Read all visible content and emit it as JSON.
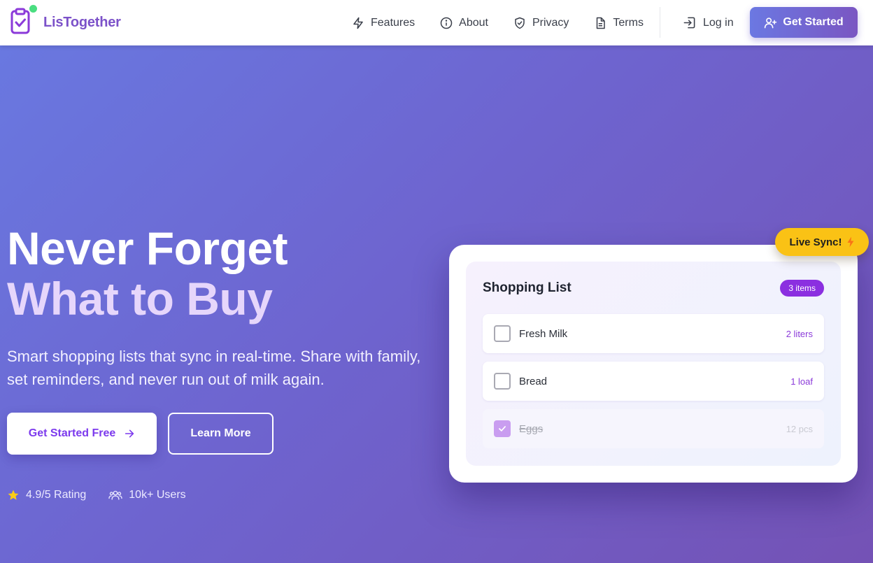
{
  "brand": {
    "name": "LisTogether",
    "accent": "#7c52c9",
    "status_dot": "#4ade80"
  },
  "nav": {
    "links": [
      {
        "label": "Features",
        "icon": "lightning-icon"
      },
      {
        "label": "About",
        "icon": "info-icon"
      },
      {
        "label": "Privacy",
        "icon": "shield-icon"
      },
      {
        "label": "Terms",
        "icon": "document-icon"
      }
    ],
    "login": "Log in",
    "cta": "Get Started"
  },
  "hero": {
    "title_line1": "Never Forget",
    "title_line2": "What to Buy",
    "subtitle": "Smart shopping lists that sync in real-time. Share with family, set reminders, and never run out of milk again.",
    "primary_button": "Get Started Free",
    "secondary_button": "Learn More",
    "stats": [
      {
        "label": "4.9/5 Rating",
        "icon": "star-icon"
      },
      {
        "label": "10k+ Users",
        "icon": "users-icon"
      }
    ]
  },
  "card": {
    "title": "Shopping List",
    "badge": "3 items",
    "items": [
      {
        "name": "Fresh Milk",
        "qty": "2 liters",
        "checked": false
      },
      {
        "name": "Bread",
        "qty": "1 loaf",
        "checked": false
      },
      {
        "name": "Eggs",
        "qty": "12 pcs",
        "checked": true
      }
    ],
    "live_sync": "Live Sync!"
  },
  "colors": {
    "primary_purple": "#7c3aed",
    "badge_purple": "#8b2fe0",
    "live_sync_yellow": "#fac215",
    "hero_gradient_start": "#6978e0",
    "hero_gradient_end": "#7452b5"
  }
}
